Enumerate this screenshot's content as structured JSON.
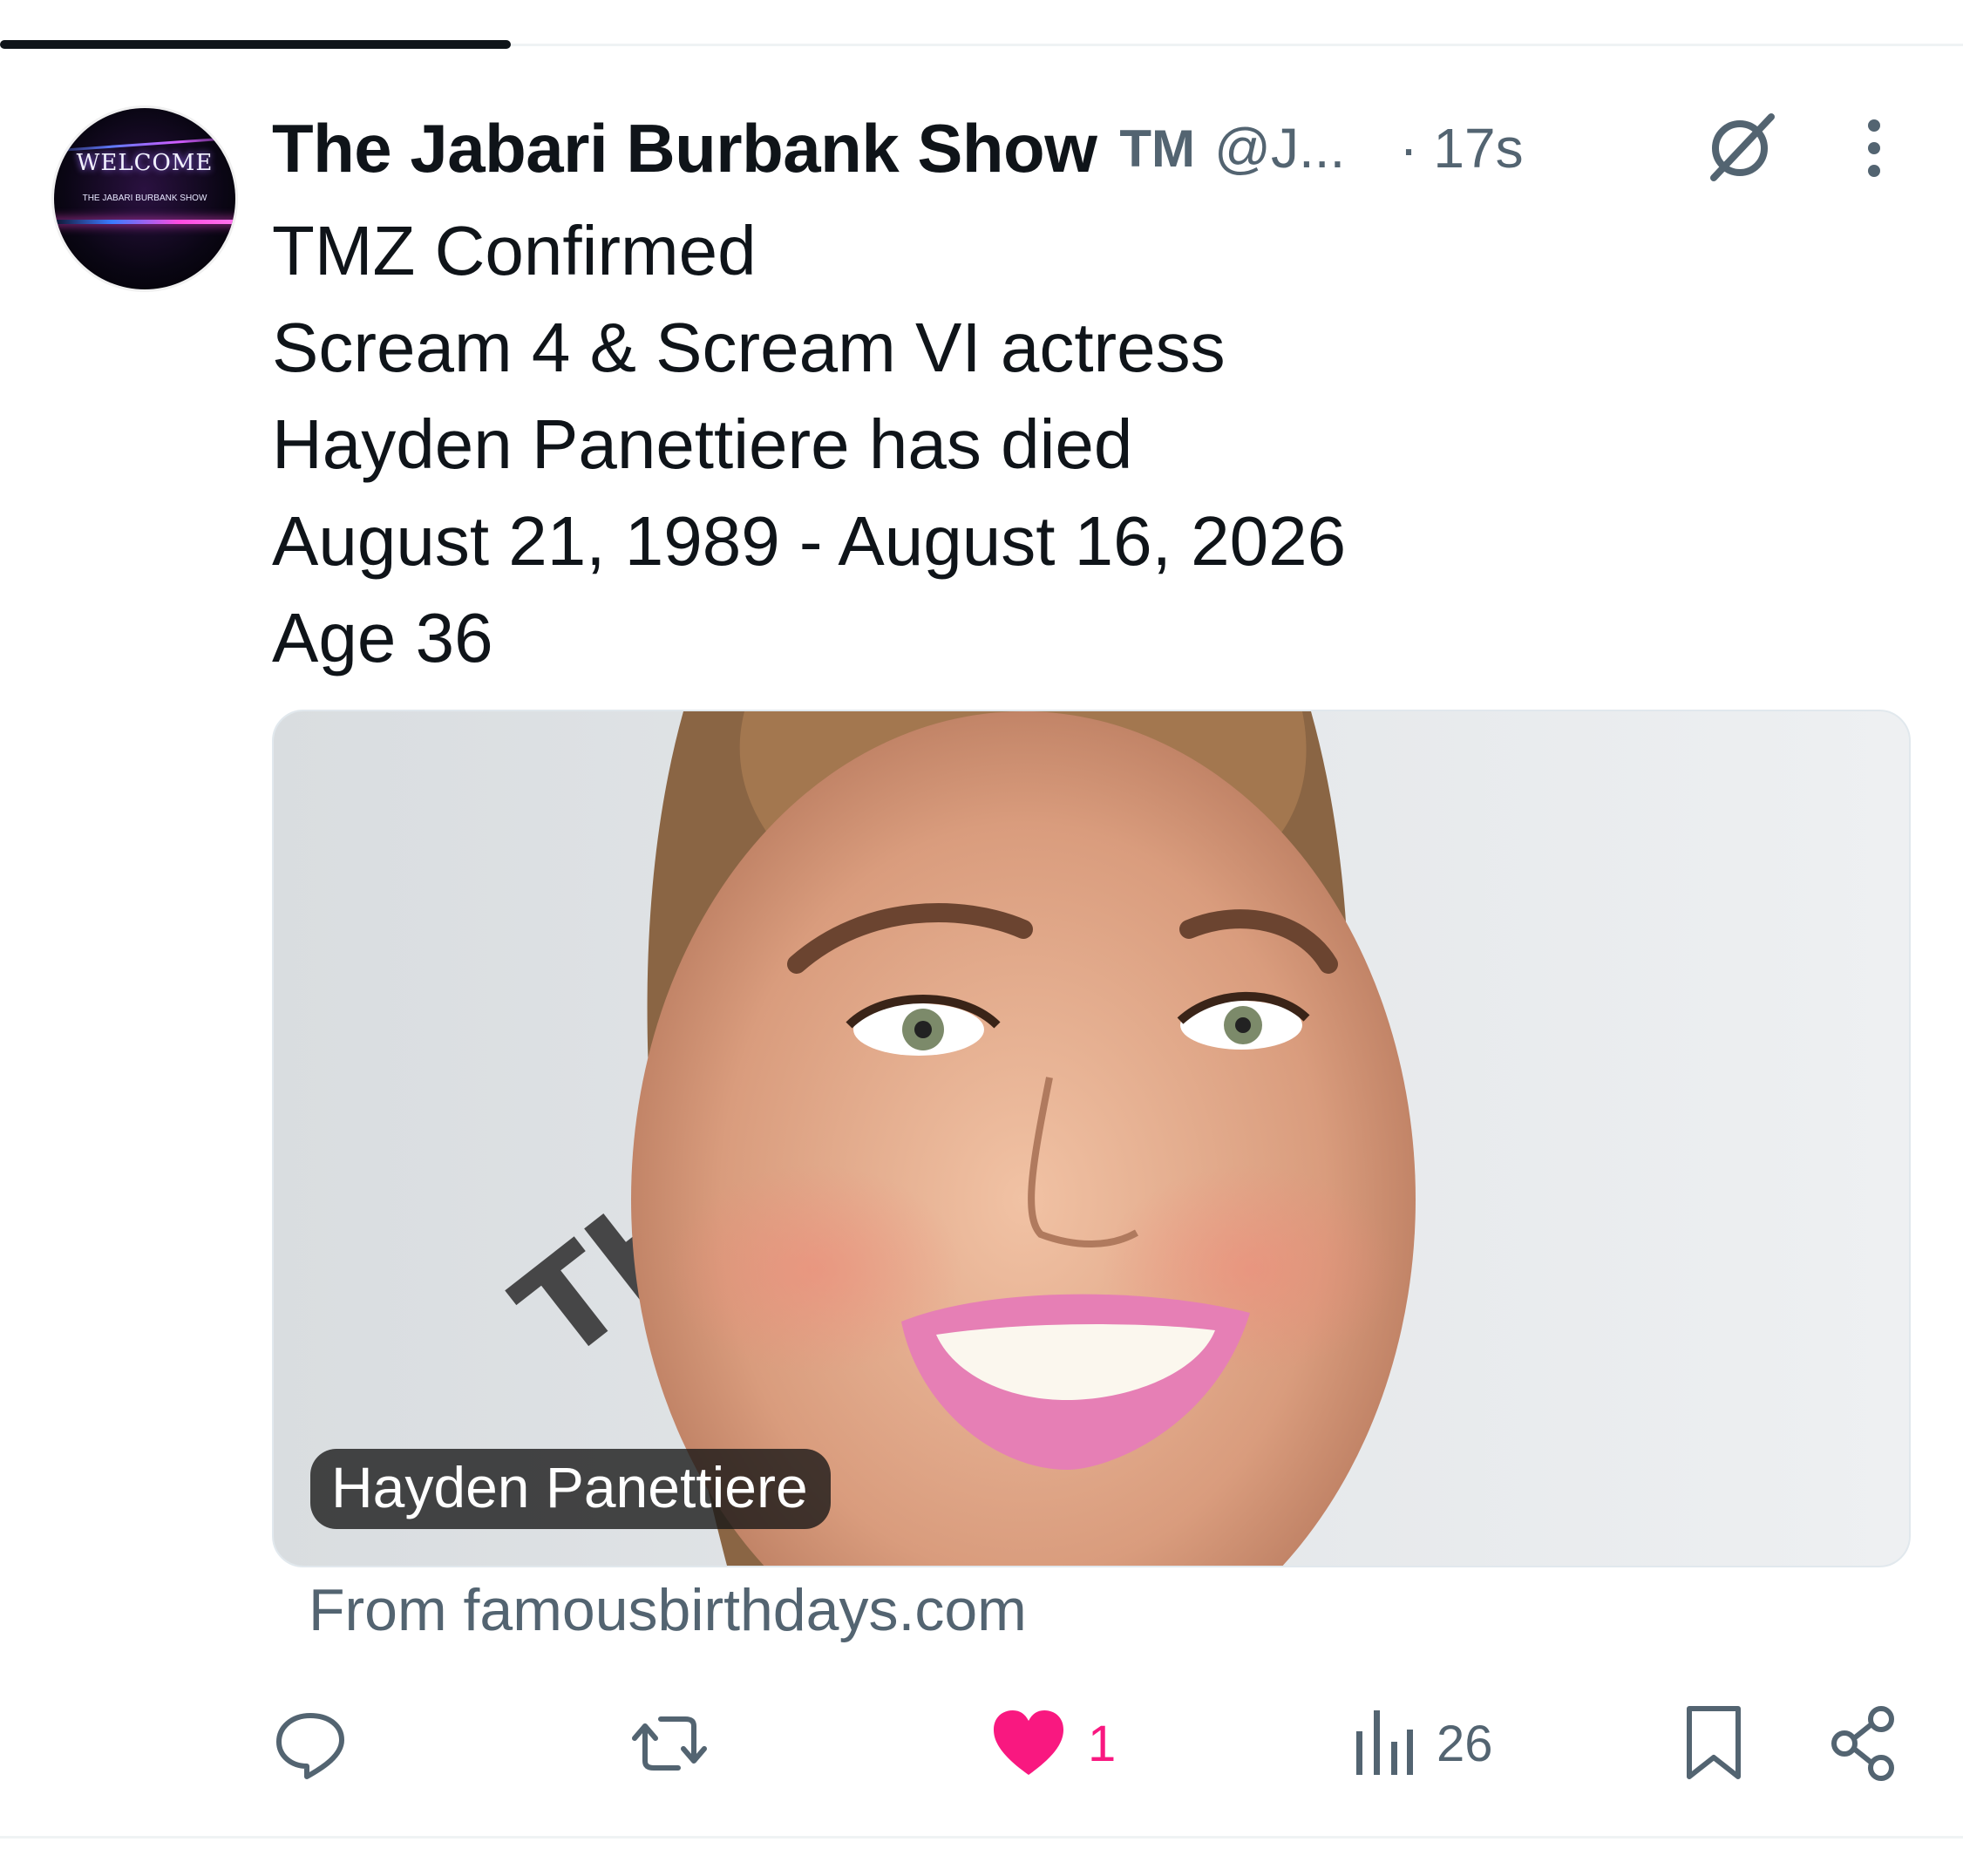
{
  "progress": {
    "fraction": 0.26
  },
  "author": {
    "avatar": {
      "text_top": "WELCOME",
      "text_bottom": "THE JABARI BURBANK SHOW"
    },
    "display_name": "The Jabari Burbank Show",
    "badge": "TM",
    "handle": "@J...",
    "time": "· 17s"
  },
  "post": {
    "lines": [
      "TMZ Confirmed",
      "Scream 4 & Scream VI actress",
      "Hayden Panettiere has died",
      "August 21, 1989 - August 16, 2026",
      "Age 36"
    ]
  },
  "media": {
    "caption": "Hayden Panettiere",
    "backdrop_text": "TH",
    "source": "From famousbirthdays.com"
  },
  "actions": {
    "reply_icon": "reply-icon",
    "repost_icon": "repost-icon",
    "like_icon": "heart-filled-icon",
    "like_count": "1",
    "views_icon": "bar-chart-icon",
    "views_count": "26",
    "bookmark_icon": "bookmark-icon",
    "share_icon": "share-icon"
  },
  "colors": {
    "text": "#0f1419",
    "secondary": "#536471",
    "like_pink": "#f91880",
    "divider": "#eff3f4"
  }
}
